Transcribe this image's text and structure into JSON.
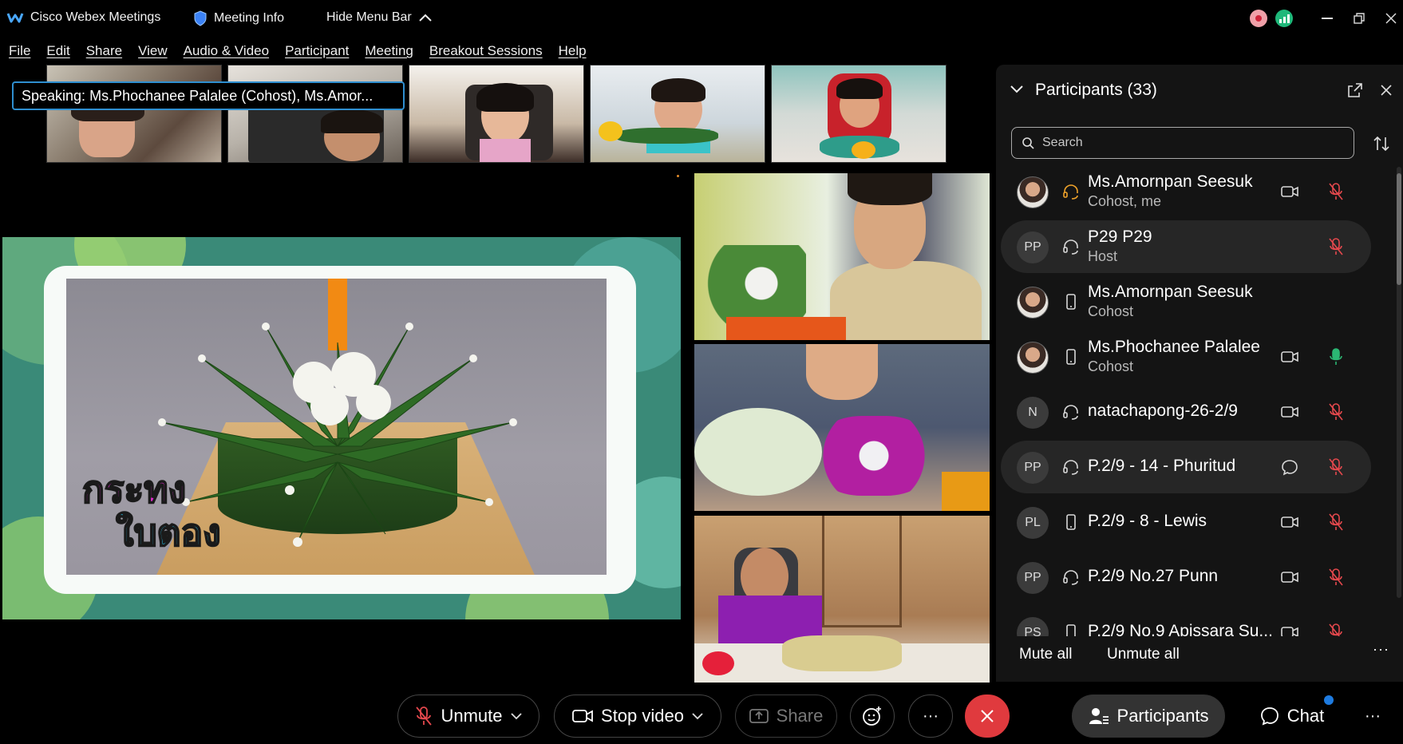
{
  "app_title": "Cisco Webex Meetings",
  "meeting_info": "Meeting Info",
  "hide_menu_bar": "Hide Menu Bar",
  "menu": [
    "File",
    "Edit",
    "Share",
    "View",
    "Audio & Video",
    "Participant",
    "Meeting",
    "Breakout Sessions",
    "Help"
  ],
  "speaking": {
    "label": "Speaking:",
    "names": "Ms.Phochanee Palalee (Cohost), Ms.Amor..."
  },
  "stage": {
    "caption_line1": "กระทง",
    "caption_line2": "ใบตอง"
  },
  "panel": {
    "title": "Participants (33)",
    "search_placeholder": "Search",
    "mute_all": "Mute all",
    "unmute_all": "Unmute all"
  },
  "participants": [
    {
      "initials": "",
      "name": "Ms.Amornpan Seesuk",
      "role": "Cohost, me",
      "device": "headset",
      "video": true,
      "mic": "muted",
      "photo": true
    },
    {
      "initials": "PP",
      "name": "P29 P29",
      "role": "Host",
      "device": "headset",
      "video": false,
      "mic": "muted",
      "photo": false
    },
    {
      "initials": "",
      "name": "Ms.Amornpan Seesuk",
      "role": "Cohost",
      "device": "phone",
      "video": false,
      "mic": "none",
      "photo": true
    },
    {
      "initials": "",
      "name": "Ms.Phochanee Palalee",
      "role": "Cohost",
      "device": "phone",
      "video": true,
      "mic": "active",
      "photo": true
    },
    {
      "initials": "N",
      "name": "natachapong-26-2/9",
      "role": "",
      "device": "headset",
      "video": true,
      "mic": "muted",
      "photo": false
    },
    {
      "initials": "PP",
      "name": "P.2/9 - 14 - Phuritud",
      "role": "",
      "device": "headset",
      "video": "chat",
      "mic": "muted",
      "photo": false
    },
    {
      "initials": "PL",
      "name": "P.2/9 - 8 - Lewis",
      "role": "",
      "device": "phone",
      "video": true,
      "mic": "muted",
      "photo": false
    },
    {
      "initials": "PP",
      "name": "P.2/9 No.27 Punn",
      "role": "",
      "device": "headset",
      "video": true,
      "mic": "muted",
      "photo": false
    },
    {
      "initials": "PS",
      "name": "P.2/9 No.9 Apissara Su...",
      "role": "",
      "device": "phone",
      "video": true,
      "mic": "muted",
      "photo": false
    }
  ],
  "controls": {
    "unmute": "Unmute",
    "stop_video": "Stop video",
    "share": "Share",
    "participants": "Participants",
    "chat": "Chat"
  },
  "colors": {
    "accent_blue": "#2f8fd0",
    "end_red": "#e03a3e",
    "muted_red": "#e5484d",
    "mic_green": "#2bb673"
  }
}
